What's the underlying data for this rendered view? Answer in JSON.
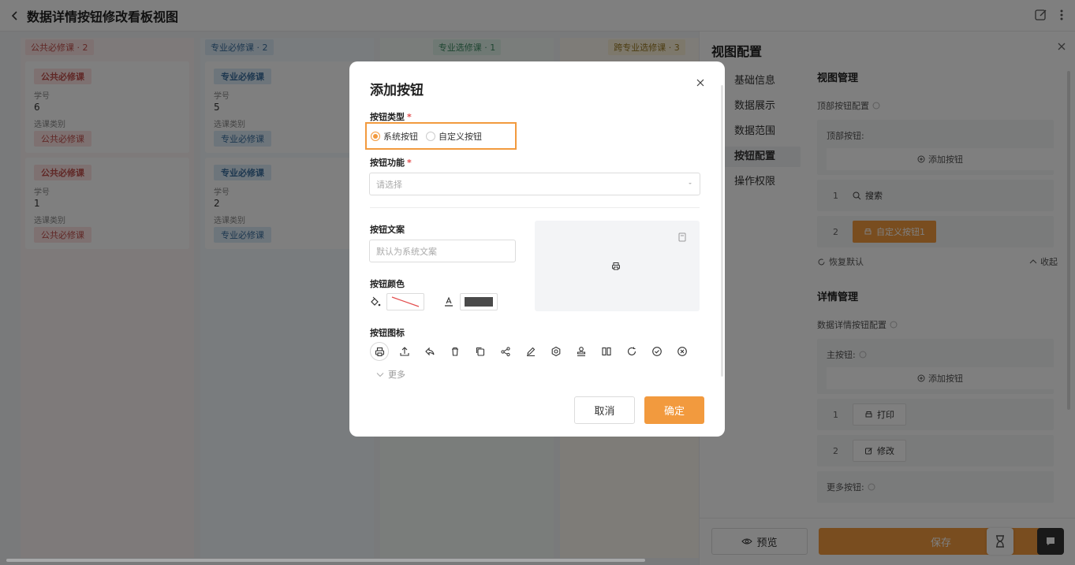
{
  "header": {
    "title": "数据详情按钮修改看板视图"
  },
  "colors": {
    "accent": "#f29a3e",
    "required": "#e34d4d"
  },
  "board": {
    "columns": [
      {
        "title": "公共必修课 · 2",
        "tag_bg": "#fde2e2",
        "tag_color": "#c0504d",
        "bg": "#fcf5f5",
        "cards": [
          {
            "badge": "公共必修课",
            "f1_label": "学号",
            "f1_value": "6",
            "f2_label": "选课类别",
            "f2_value": "公共必修课"
          },
          {
            "badge": "公共必修课",
            "f1_label": "学号",
            "f1_value": "1",
            "f2_label": "选课类别",
            "f2_value": "公共必修课"
          }
        ]
      },
      {
        "title": "专业必修课 · 2",
        "tag_bg": "#dbeaf7",
        "tag_color": "#3a6f9e",
        "bg": "#f3f8fc",
        "cards": [
          {
            "badge": "专业必修课",
            "f1_label": "学号",
            "f1_value": "5",
            "f2_label": "选课类别",
            "f2_value": "专业必修课"
          },
          {
            "badge": "专业必修课",
            "f1_label": "学号",
            "f1_value": "2",
            "f2_label": "选课类别",
            "f2_value": "专业必修课"
          }
        ]
      },
      {
        "title": "专业选修课 · 1",
        "tag_bg": "#dff3e9",
        "tag_color": "#3d8a63",
        "bg": "#f4faf6",
        "cards": []
      },
      {
        "title": "跨专业选修课 · 3",
        "tag_bg": "#fbf1d6",
        "tag_color": "#9a7a25",
        "bg": "#fcf9f0",
        "cards": []
      }
    ]
  },
  "panel": {
    "title": "视图配置",
    "nav": [
      "基础信息",
      "数据展示",
      "数据范围",
      "按钮配置",
      "操作权限"
    ],
    "view_mgmt": {
      "heading": "视图管理",
      "top_config_label": "顶部按钮配置",
      "top_buttons_label": "顶部按钮:",
      "add_button": "添加按钮",
      "items": [
        {
          "index": "1",
          "label": "搜索"
        },
        {
          "index": "2",
          "label": "自定义按钮1"
        }
      ],
      "restore": "恢复默认",
      "collapse": "收起"
    },
    "detail_mgmt": {
      "heading": "详情管理",
      "config_label": "数据详情按钮配置",
      "main_label": "主按钮:",
      "add_button": "添加按钮",
      "items": [
        {
          "index": "1",
          "label": "打印"
        },
        {
          "index": "2",
          "label": "修改"
        }
      ],
      "more_label": "更多按钮:"
    },
    "footer": {
      "preview": "预览",
      "save": "保存"
    }
  },
  "modal": {
    "title": "添加按钮",
    "type_label": "按钮类型",
    "type_options": [
      "系统按钮",
      "自定义按钮"
    ],
    "type_selected": "系统按钮",
    "function_label": "按钮功能",
    "function_placeholder": "请选择",
    "text_label": "按钮文案",
    "text_placeholder": "默认为系统文案",
    "color_label": "按钮颜色",
    "text_color": "#4a4a4a",
    "icon_label": "按钮图标",
    "icons": [
      "printer-icon",
      "upload-icon",
      "reply-icon",
      "trash-icon",
      "copy-icon",
      "share-icon",
      "edit-icon",
      "settings-icon",
      "stamp-icon",
      "columns-icon",
      "refresh-icon",
      "check-circle-icon",
      "close-circle-icon"
    ],
    "more": "更多",
    "cancel": "取消",
    "ok": "确定"
  }
}
